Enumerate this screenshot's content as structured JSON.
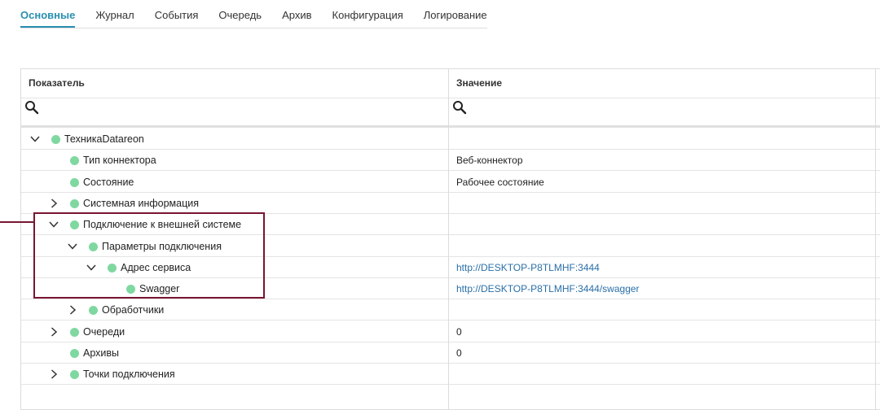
{
  "tabs": [
    {
      "label": "Основные",
      "active": true
    },
    {
      "label": "Журнал",
      "active": false
    },
    {
      "label": "События",
      "active": false
    },
    {
      "label": "Очередь",
      "active": false
    },
    {
      "label": "Архив",
      "active": false
    },
    {
      "label": "Конфигурация",
      "active": false
    },
    {
      "label": "Логирование",
      "active": false
    }
  ],
  "grid": {
    "columns": [
      {
        "header": "Показатель",
        "filter_value": ""
      },
      {
        "header": "Значение",
        "filter_value": ""
      }
    ],
    "rows": [
      {
        "name": "ТехникаDatareon",
        "value": "",
        "expander": "expanded",
        "link": false
      },
      {
        "name": "Тип коннектора",
        "value": "Веб-коннектор",
        "expander": "none",
        "link": false
      },
      {
        "name": "Состояние",
        "value": "Рабочее состояние",
        "expander": "none",
        "link": false
      },
      {
        "name": "Системная информация",
        "value": "",
        "expander": "collapsed",
        "link": false
      },
      {
        "name": "Подключение к внешней системе",
        "value": "",
        "expander": "expanded",
        "link": false
      },
      {
        "name": "Параметры подключения",
        "value": "",
        "expander": "expanded",
        "link": false
      },
      {
        "name": "Адрес сервиса",
        "value": "http://DESKTOP-P8TLMHF:3444",
        "expander": "expanded",
        "link": true
      },
      {
        "name": "Swagger",
        "value": "http://DESKTOP-P8TLMHF:3444/swagger",
        "expander": "none",
        "link": true
      },
      {
        "name": "Обработчики",
        "value": "",
        "expander": "collapsed",
        "link": false
      },
      {
        "name": "Очереди",
        "value": "0",
        "expander": "collapsed",
        "link": false
      },
      {
        "name": "Архивы",
        "value": "0",
        "expander": "none",
        "link": false
      },
      {
        "name": "Точки подключения",
        "value": "",
        "expander": "collapsed",
        "link": false
      }
    ]
  },
  "colors": {
    "accent": "#2a8fb0",
    "link": "#2a6fa8",
    "status_dot": "#7fd8a0",
    "highlight": "#7a1530"
  }
}
